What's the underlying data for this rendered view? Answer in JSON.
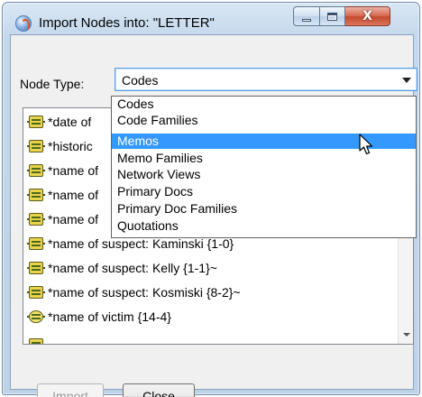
{
  "window": {
    "title": "Import Nodes into: \"LETTER\"",
    "app_icon": "atlas-ti-globe-icon",
    "controls": {
      "minimize": "minimize-icon",
      "maximize": "maximize-icon",
      "close": "close-icon",
      "close_glyph": "X"
    }
  },
  "node_type": {
    "label": "Node Type:",
    "selected": "Codes"
  },
  "dropdown": {
    "options": [
      "Codes",
      "Code Families",
      "Memos",
      "Memo Families",
      "Network Views",
      "Primary Docs",
      "Primary Doc Families",
      "Quotations"
    ],
    "highlighted": "Memos"
  },
  "list": {
    "items": [
      {
        "text": "*date of",
        "icon": "code-icon"
      },
      {
        "text": "*historic",
        "icon": "code-icon"
      },
      {
        "text": "*name of",
        "icon": "code-icon"
      },
      {
        "text": "*name of",
        "icon": "code-icon"
      },
      {
        "text": "*name of",
        "icon": "code-icon"
      },
      {
        "text": "*name of suspect: Kaminski {1-0}",
        "icon": "code-icon"
      },
      {
        "text": "*name of suspect: Kelly {1-1}~",
        "icon": "code-icon"
      },
      {
        "text": "*name of suspect: Kosmiski {8-2}~",
        "icon": "code-icon"
      },
      {
        "text": "*name of victim {14-4}",
        "icon": "code-star-icon"
      }
    ]
  },
  "buttons": {
    "import": "Import",
    "close": "Close"
  },
  "colors": {
    "selection": "#3399ff",
    "focus_border": "#569de5",
    "disabled_text": "#9b9b9b"
  }
}
